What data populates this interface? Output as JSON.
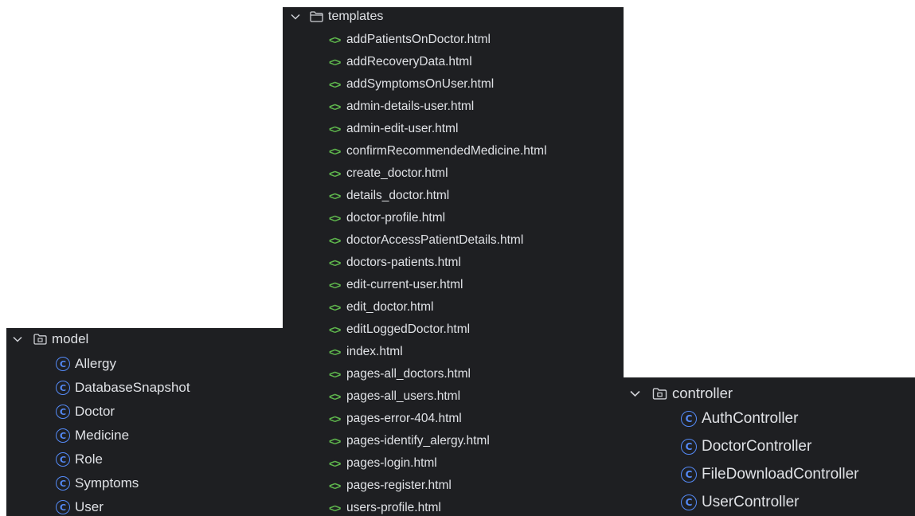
{
  "templates": {
    "folder_name": "templates",
    "files": [
      "addPatientsOnDoctor.html",
      "addRecoveryData.html",
      "addSymptomsOnUser.html",
      "admin-details-user.html",
      "admin-edit-user.html",
      "confirmRecommendedMedicine.html",
      "create_doctor.html",
      "details_doctor.html",
      "doctor-profile.html",
      "doctorAccessPatientDetails.html",
      "doctors-patients.html",
      "edit-current-user.html",
      "edit_doctor.html",
      "editLoggedDoctor.html",
      "index.html",
      "pages-all_doctors.html",
      "pages-all_users.html",
      "pages-error-404.html",
      "pages-identify_alergy.html",
      "pages-login.html",
      "pages-register.html",
      "users-profile.html"
    ]
  },
  "model": {
    "package_name": "model",
    "classes": [
      "Allergy",
      "DatabaseSnapshot",
      "Doctor",
      "Medicine",
      "Role",
      "Symptoms",
      "User"
    ]
  },
  "controller": {
    "package_name": "controller",
    "classes": [
      "AuthController",
      "DoctorController",
      "FileDownloadController",
      "UserController"
    ]
  },
  "icons": {
    "html_file_icon": "<>",
    "class_icon": "C",
    "folder_icon": "folder-icon",
    "package_icon": "package-icon",
    "expand_icon": "chevron-down-icon"
  },
  "colors": {
    "panel_bg": "#1e1f22",
    "text": "#dfe1e5",
    "html_icon": "#5fb84d",
    "class_icon": "#548af7"
  }
}
